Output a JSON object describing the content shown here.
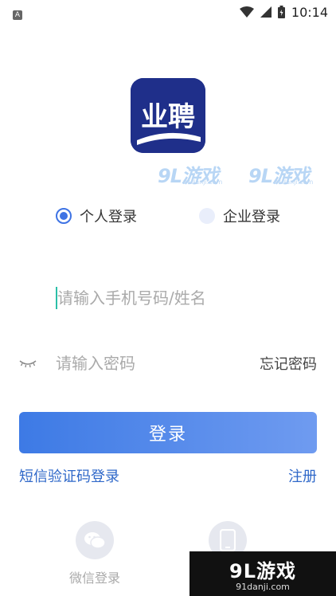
{
  "status_bar": {
    "time": "10:14",
    "left_icon": "A",
    "icons": [
      "wifi-icon",
      "signal-icon",
      "battery-icon"
    ]
  },
  "logo": {
    "text": "业聘",
    "color": "#1f2f8a"
  },
  "watermark": {
    "top_brand": "9L游戏",
    "top_url": "91danji.com",
    "corner_brand": "9L游戏",
    "corner_url": "91danji.com"
  },
  "login_type": {
    "options": [
      {
        "label": "个人登录",
        "selected": true
      },
      {
        "label": "企业登录",
        "selected": false
      }
    ]
  },
  "form": {
    "phone_placeholder": "请输入手机号码/姓名",
    "phone_value": "",
    "password_placeholder": "请输入密码",
    "password_value": "",
    "forgot_password": "忘记密码",
    "submit_label": "登录"
  },
  "links": {
    "sms_login": "短信验证码登录",
    "register": "注册"
  },
  "social": {
    "wechat_label": "微信登录",
    "phone_label": "手机"
  },
  "colors": {
    "accent": "#3e73e4",
    "link": "#2f68c9",
    "button_start": "#3d7ae5",
    "button_end": "#6f9bf0"
  }
}
